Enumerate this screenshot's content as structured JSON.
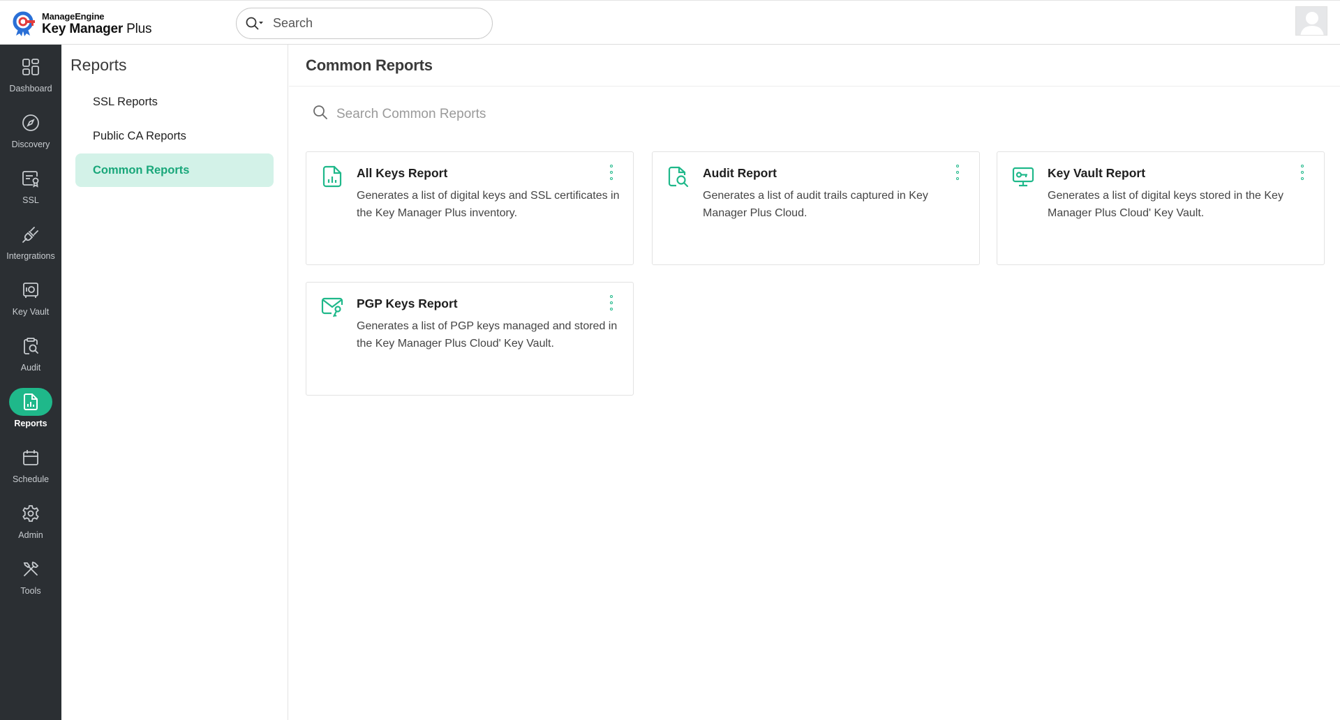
{
  "header": {
    "brand": "ManageEngine",
    "product_name": "Key Manager",
    "product_suffix": "Plus",
    "search_placeholder": "Search"
  },
  "rail": {
    "items": [
      {
        "label": "Dashboard",
        "icon": "dashboard-icon"
      },
      {
        "label": "Discovery",
        "icon": "compass-icon"
      },
      {
        "label": "SSL",
        "icon": "certificate-icon"
      },
      {
        "label": "Intergrations",
        "icon": "plug-icon"
      },
      {
        "label": "Key Vault",
        "icon": "vault-icon"
      },
      {
        "label": "Audit",
        "icon": "audit-icon"
      },
      {
        "label": "Reports",
        "icon": "reports-icon",
        "active": true
      },
      {
        "label": "Schedule",
        "icon": "calendar-icon"
      },
      {
        "label": "Admin",
        "icon": "gear-icon"
      },
      {
        "label": "Tools",
        "icon": "tools-icon"
      }
    ]
  },
  "subnav": {
    "title": "Reports",
    "items": [
      {
        "label": "SSL Reports"
      },
      {
        "label": "Public CA Reports"
      },
      {
        "label": "Common Reports",
        "active": true
      }
    ]
  },
  "main": {
    "title": "Common Reports",
    "search_placeholder": "Search Common Reports",
    "cards": [
      {
        "title": "All Keys Report",
        "description": "Generates a list of digital keys and SSL certificates in the Key Manager Plus inventory.",
        "icon": "report-chart-icon"
      },
      {
        "title": "Audit Report",
        "description": "Generates a list of audit trails captured in Key Manager Plus Cloud.",
        "icon": "audit-search-icon"
      },
      {
        "title": "Key Vault Report",
        "description": "Generates a list of digital keys stored in the Key Manager Plus Cloud' Key Vault.",
        "icon": "key-monitor-icon"
      },
      {
        "title": "PGP Keys Report",
        "description": "Generates a list of PGP keys managed and stored in the Key Manager Plus Cloud' Key Vault.",
        "icon": "mail-key-icon"
      }
    ]
  },
  "colors": {
    "accent": "#1fb88a",
    "rail_bg": "#2b2f33",
    "active_subnav_bg": "#d3f2e8"
  }
}
